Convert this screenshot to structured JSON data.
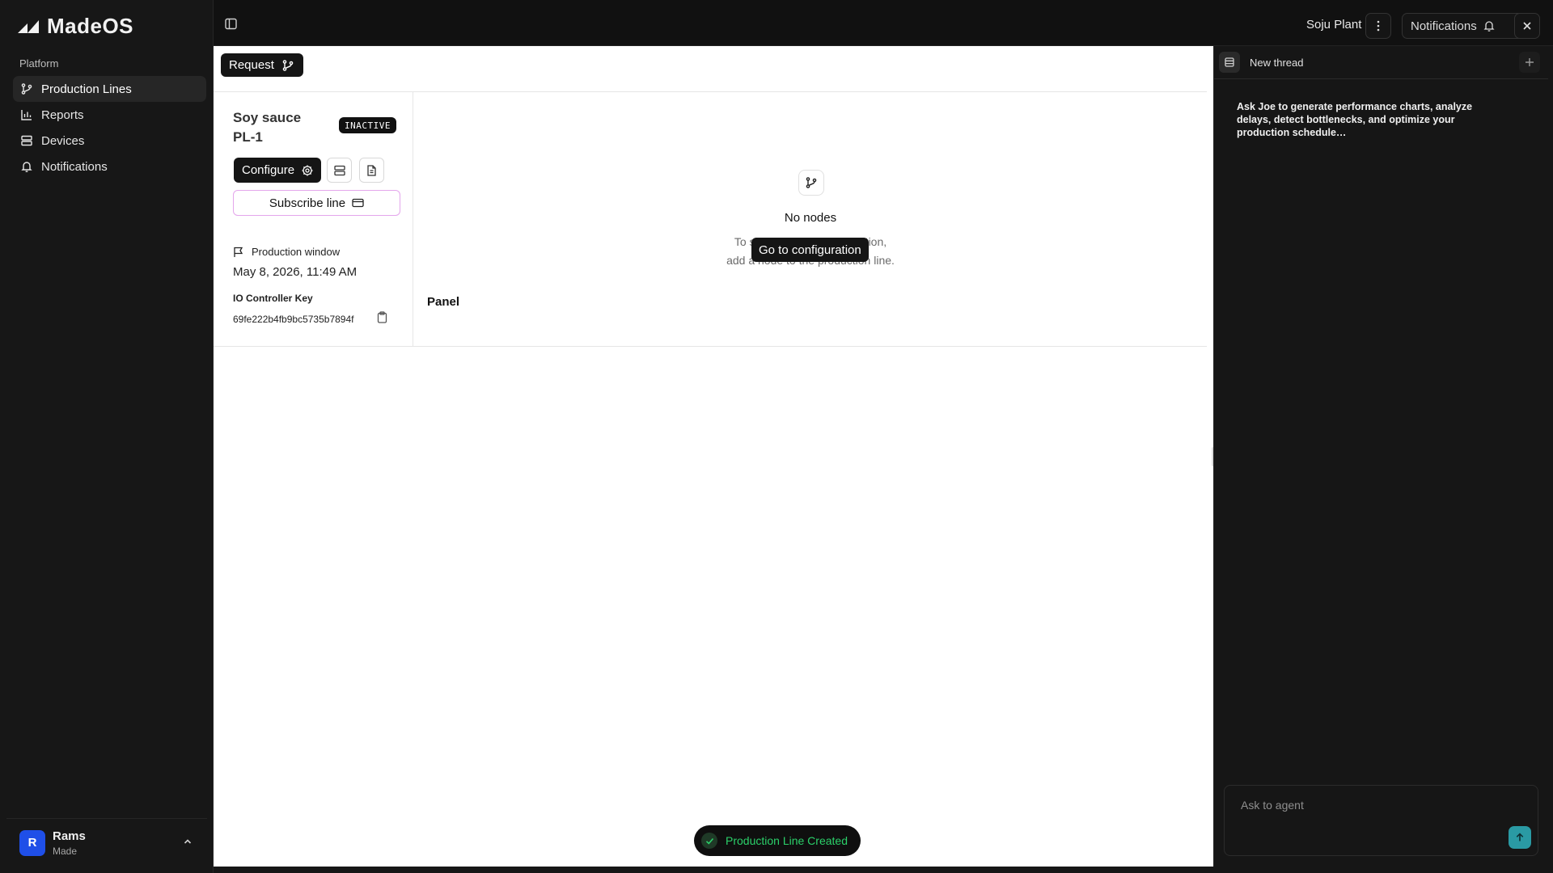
{
  "app": {
    "name": "MadeOS"
  },
  "sidebar": {
    "group_label": "Platform",
    "items": [
      {
        "label": "Production Lines",
        "icon": "branch-icon",
        "active": true
      },
      {
        "label": "Reports",
        "icon": "bar-chart-icon",
        "active": false
      },
      {
        "label": "Devices",
        "icon": "server-icon",
        "active": false
      },
      {
        "label": "Notifications",
        "icon": "bell-icon",
        "active": false
      }
    ],
    "user": {
      "initial": "R",
      "name": "Rams",
      "org": "Made"
    }
  },
  "topbar": {
    "plant_name": "Soju Plant",
    "notifications_label": "Notifications"
  },
  "main": {
    "request_label": "Request",
    "line": {
      "title": "Soy sauce PL-1",
      "status": "INACTIVE",
      "configure_label": "Configure",
      "subscribe_label": "Subscribe line",
      "production_window_label": "Production window",
      "production_window_value": "May 8, 2026, 11:49 AM",
      "io_key_label": "IO Controller Key",
      "io_key_value": "69fe222b4fb9bc5735b7894f"
    },
    "empty_state": {
      "title": "No nodes",
      "desc_line1": "To start monitoring production,",
      "desc_line2": "add a node to the production line.",
      "button_label": "Go to configuration"
    },
    "panel_label": "Panel",
    "toast": "Production Line Created"
  },
  "agent": {
    "thread_title": "New thread",
    "intro": "Ask Joe to generate performance charts, analyze delays, detect bottlenecks, and optimize your production schedule…",
    "input_placeholder": "Ask to agent"
  },
  "colors": {
    "accent_blue": "#1f4fe8",
    "send_teal": "#2a9aa4",
    "toast_green": "#2bd16a",
    "subscribe_border": "#e4a6ec"
  }
}
